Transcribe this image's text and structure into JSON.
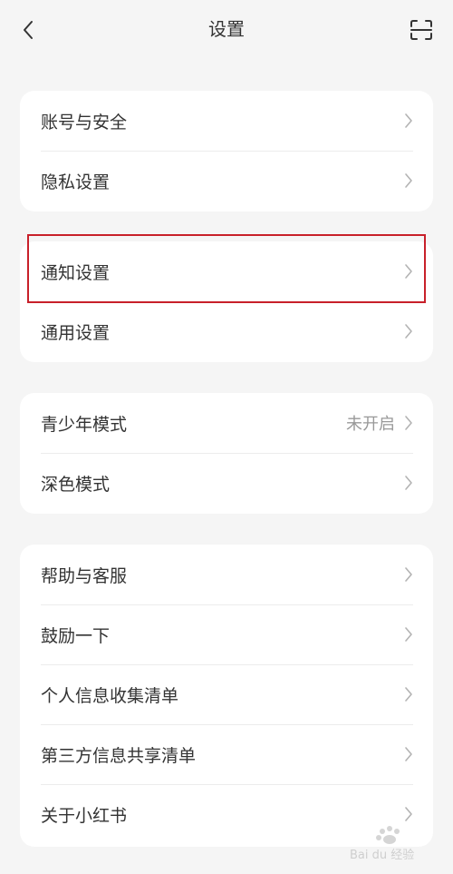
{
  "header": {
    "title": "设置",
    "back_icon": "chevron-left-icon",
    "scan_icon": "scan-icon"
  },
  "groups": [
    {
      "items": [
        {
          "label": "账号与安全"
        },
        {
          "label": "隐私设置"
        }
      ]
    },
    {
      "items": [
        {
          "label": "通知设置"
        },
        {
          "label": "通用设置"
        }
      ]
    },
    {
      "items": [
        {
          "label": "青少年模式",
          "value": "未开启"
        },
        {
          "label": "深色模式"
        }
      ]
    },
    {
      "items": [
        {
          "label": "帮助与客服"
        },
        {
          "label": "鼓励一下"
        },
        {
          "label": "个人信息收集清单"
        },
        {
          "label": "第三方信息共享清单"
        },
        {
          "label": "关于小红书"
        }
      ]
    }
  ],
  "colors": {
    "background": "#f5f5f5",
    "card": "#ffffff",
    "text": "#333333",
    "secondary_text": "#999999",
    "chevron": "#b3b3b3",
    "highlight": "#c8202a"
  },
  "watermark": {
    "icon": "baidu-jingyan-logo",
    "text": "Bai du 经验"
  }
}
